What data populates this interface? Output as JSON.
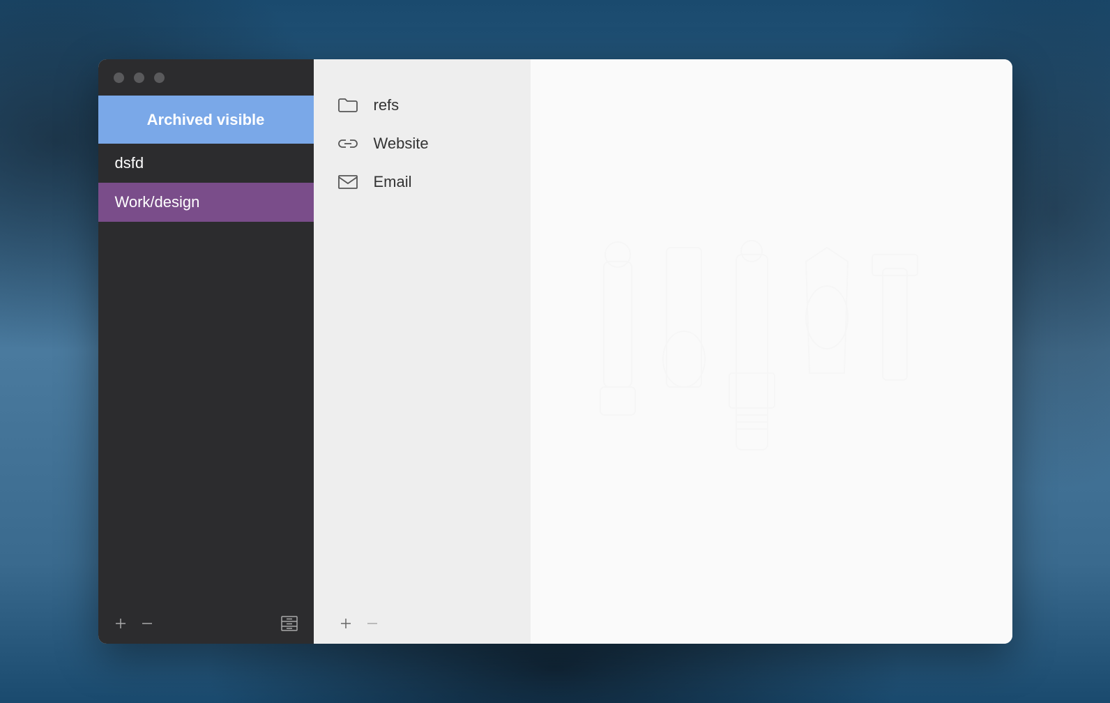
{
  "header": {
    "banner": "Archived visible"
  },
  "sidebar": {
    "items": [
      {
        "label": "dsfd",
        "selected": false
      },
      {
        "label": "Work/design",
        "selected": true
      }
    ]
  },
  "middle": {
    "items": [
      {
        "icon": "folder",
        "label": "refs"
      },
      {
        "icon": "link",
        "label": "Website"
      },
      {
        "icon": "mail",
        "label": "Email"
      }
    ]
  },
  "colors": {
    "sidebar_bg": "#2c2c2e",
    "banner_bg": "#7aa8e8",
    "selected_bg": "#7a4d8a",
    "middle_bg": "#eeeeee",
    "content_bg": "#fafafa"
  }
}
